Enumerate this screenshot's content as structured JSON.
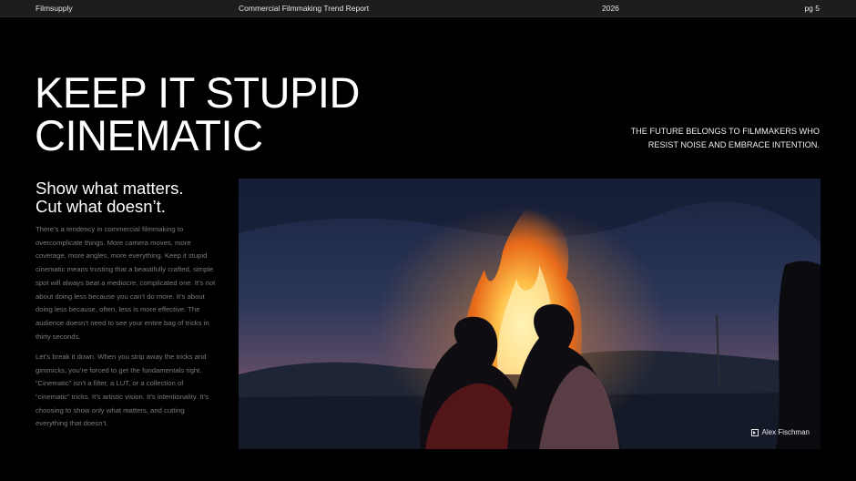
{
  "header": {
    "brand": "Filmsupply",
    "report_title": "Commercial Filmmaking Trend Report",
    "year": "2026",
    "page": "pg 5"
  },
  "hero": {
    "title_line1": "KEEP IT STUPID",
    "title_line2": "CINEMATIC",
    "tagline_line1": "THE FUTURE BELONGS TO FILMMAKERS WHO",
    "tagline_line2": "RESIST NOISE AND EMBRACE INTENTION."
  },
  "article": {
    "subhead_line1": "Show what matters.",
    "subhead_line2": "Cut what doesn’t.",
    "paragraph1": "There’s a tendency in commercial filmmaking to overcomplicate things. More camera moves, more coverage, more angles, more everything. Keep it stupid cinematic means trusting that a beautifully crafted, simple spot will always beat a mediocre, complicated one. It’s not about doing less because you can’t do more. It’s about doing less because, often, less is more effective. The audience doesn’t need to see your entire bag of tricks in thirty seconds.",
    "paragraph2": "Let’s break it down. When you strip away the tricks and gimmicks, you’re forced to get the fundamentals right. “Cinematic” isn’t a filter, a LUT, or a collection of “cinematic” tricks. It’s artistic vision. It’s intentionality. It’s choosing to show only what matters, and cutting everything that doesn’t."
  },
  "photo": {
    "credit": "Alex Fischman",
    "credit_icon": "play-square-icon",
    "subject": "two people embracing in front of a bonfire at dusk"
  },
  "colors": {
    "background": "#000000",
    "topbar": "#1d1d1d",
    "body_text": "#7a7a7a",
    "heading_text": "#ffffff"
  }
}
